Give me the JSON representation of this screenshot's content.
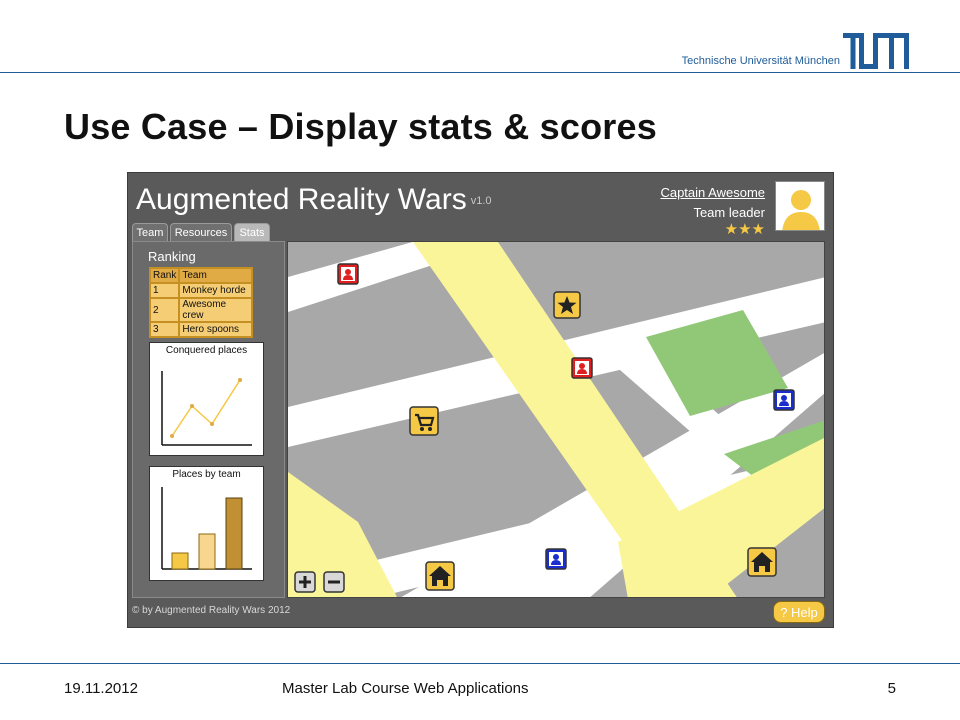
{
  "slide": {
    "university": "Technische Universität München",
    "title": "Use Case – Display stats & scores",
    "date": "19.11.2012",
    "course": "Master Lab Course Web Applications",
    "page_number": "5"
  },
  "app": {
    "name": "Augmented Reality Wars",
    "version": "v1.0",
    "user": {
      "name": "Captain Awesome",
      "role": "Team leader",
      "rating_stars": 3
    },
    "tabs": [
      {
        "label": "Team",
        "active": false
      },
      {
        "label": "Resources",
        "active": false
      },
      {
        "label": "Stats",
        "active": true
      }
    ],
    "ranking": {
      "label": "Ranking",
      "headers": [
        "Rank",
        "Team"
      ],
      "rows": [
        [
          "1",
          "Monkey horde"
        ],
        [
          "2",
          "Awesome crew"
        ],
        [
          "3",
          "Hero spoons"
        ]
      ]
    },
    "charts": {
      "conquered": {
        "title": "Conquered places",
        "type": "line"
      },
      "places": {
        "title": "Places by team",
        "type": "bar"
      }
    },
    "map": {
      "markers": [
        "player-icon",
        "star-icon",
        "shop-icon",
        "home-icon"
      ],
      "zoom_controls": [
        "plus-icon",
        "minus-icon"
      ]
    },
    "copyright": "© by Augmented Reality Wars 2012",
    "help_label": "? Help"
  },
  "colors": {
    "accent": "#1f5c99",
    "app_bg": "#5a5a5a",
    "gold": "#f5c845",
    "table_gold": "#e0aa44",
    "enemy_red": "#e02020",
    "ally_blue": "#1a2ed0",
    "park_green": "#90c878",
    "road_yellow": "#fbf59a"
  }
}
